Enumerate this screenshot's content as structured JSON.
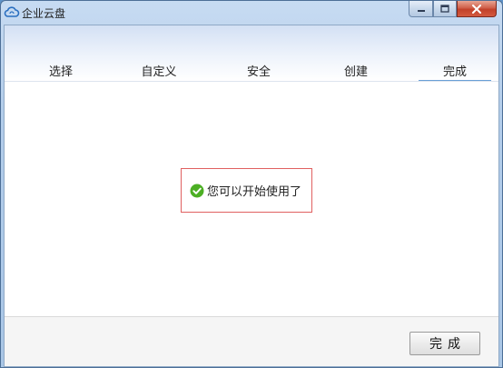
{
  "window": {
    "title": "企业云盘",
    "app_icon": "cloud-icon"
  },
  "controls": {
    "minimize_icon": "minimize-icon",
    "maximize_icon": "maximize-icon",
    "close_icon": "close-icon"
  },
  "steps": [
    {
      "label": "选择",
      "active": false
    },
    {
      "label": "自定义",
      "active": false
    },
    {
      "label": "安全",
      "active": false
    },
    {
      "label": "创建",
      "active": false
    },
    {
      "label": "完成",
      "active": true
    }
  ],
  "message": {
    "icon": "check-circle-icon",
    "text": "您可以开始使用了"
  },
  "footer": {
    "finish_label": "完成"
  },
  "colors": {
    "accent": "#6a9fd6",
    "success": "#4caf24",
    "highlight_border": "#e06060",
    "close_button": "#c2412a"
  }
}
